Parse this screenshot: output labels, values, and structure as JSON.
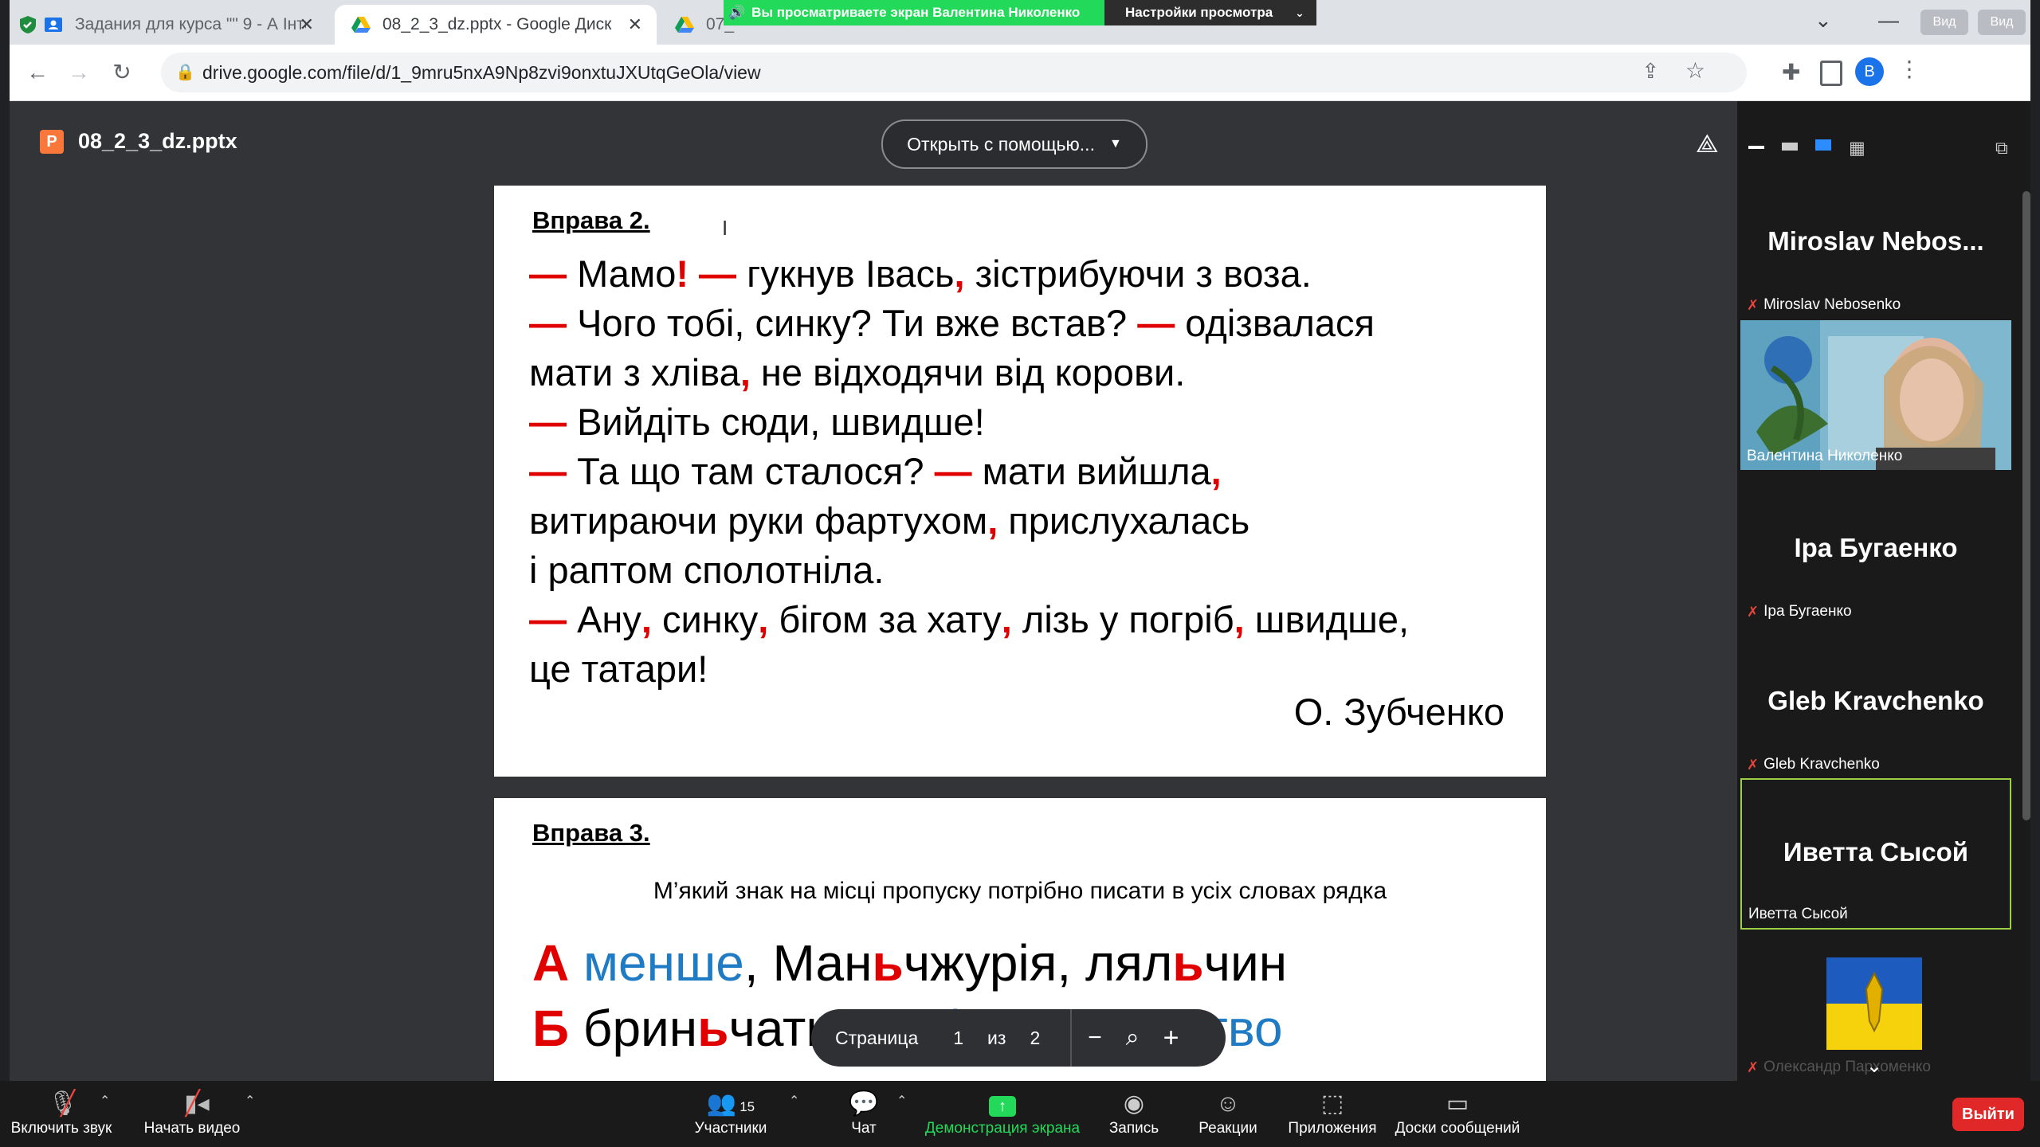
{
  "browser": {
    "tabs": [
      {
        "title": "Задания для курса \"\" 9 - А Інте"
      },
      {
        "title": "08_2_3_dz.pptx - Google Диск"
      },
      {
        "title": "07_"
      }
    ],
    "url": "drive.google.com/file/d/1_9mru5nxA9Np8zvi9onxtuJXUtqGeOla/view",
    "profile_initial": "B",
    "window_button": "Вид"
  },
  "zoom_banner": {
    "viewing_text": "Вы просматриваете экран Валентина Николенко",
    "settings_label": "Настройки просмотра"
  },
  "drive": {
    "file_icon_letter": "P",
    "file_name": "08_2_3_dz.pptx",
    "open_with_label": "Открыть с помощью..."
  },
  "slide1": {
    "title": "Вправа 2.",
    "lines": [
      [
        {
          "t": "— ",
          "c": "r"
        },
        {
          "t": "Мамо"
        },
        {
          "t": "!",
          "c": "r"
        },
        {
          "t": " — ",
          "c": "r"
        },
        {
          "t": "гукнув Івась"
        },
        {
          "t": ",",
          "c": "r"
        },
        {
          "t": " зістрибуючи з воза."
        }
      ],
      [
        {
          "t": "— ",
          "c": "r"
        },
        {
          "t": "Чого тобі, синку? Ти вже встав? "
        },
        {
          "t": "—",
          "c": "r"
        },
        {
          "t": " одізвалася"
        }
      ],
      [
        {
          "t": "мати з хліва"
        },
        {
          "t": ",",
          "c": "r"
        },
        {
          "t": " не відходячи від корови."
        }
      ],
      [
        {
          "t": "— ",
          "c": "r"
        },
        {
          "t": "Вийдіть сюди, швидше!"
        }
      ],
      [
        {
          "t": "— ",
          "c": "r"
        },
        {
          "t": "Та що там сталося? "
        },
        {
          "t": "—",
          "c": "r"
        },
        {
          "t": " мати вийшла"
        },
        {
          "t": ",",
          "c": "r"
        }
      ],
      [
        {
          "t": "витираючи руки фартухом"
        },
        {
          "t": ",",
          "c": "r"
        },
        {
          "t": " прислухалась"
        }
      ],
      [
        {
          "t": "і раптом сполотніла."
        }
      ],
      [
        {
          "t": "— ",
          "c": "r"
        },
        {
          "t": "Ану"
        },
        {
          "t": ",",
          "c": "r"
        },
        {
          "t": " синку"
        },
        {
          "t": ",",
          "c": "r"
        },
        {
          "t": " бігом за хату"
        },
        {
          "t": ",",
          "c": "r"
        },
        {
          "t": " лізь у погріб"
        },
        {
          "t": ",",
          "c": "r"
        },
        {
          "t": " швидше,"
        }
      ],
      [
        {
          "t": "це татари!"
        }
      ]
    ],
    "author": "О. Зубченко"
  },
  "slide2": {
    "title": "Вправа 3.",
    "rule": "М’який знак на місці пропуску потрібно писати в усіх словах рядка",
    "options": [
      [
        {
          "t": "А ",
          "c": "rl"
        },
        {
          "t": "менше",
          "c": "b"
        },
        {
          "t": ", Ман"
        },
        {
          "t": "ь",
          "c": "rl"
        },
        {
          "t": "чжурія, лял"
        },
        {
          "t": "ь",
          "c": "rl"
        },
        {
          "t": "чин"
        }
      ],
      [
        {
          "t": "Б ",
          "c": "rl"
        },
        {
          "t": "брин"
        },
        {
          "t": "ь",
          "c": "rl"
        },
        {
          "t": "чати, "
        },
        {
          "t": "камінчик, панство",
          "c": "b"
        }
      ]
    ]
  },
  "pager": {
    "page_label": "Страница",
    "current": "1",
    "of_label": "из",
    "total": "2"
  },
  "participants": [
    {
      "big": "Miroslav  Nebos...",
      "small": "Miroslav Nebosenko",
      "muted": true
    },
    {
      "big": "",
      "small": "Валентина Николенко",
      "muted": false,
      "video": true
    },
    {
      "big": "Іра Бугаенко",
      "small": "Іра Бугаенко",
      "muted": true
    },
    {
      "big": "Gleb Kravchenko",
      "small": "Gleb Kravchenko",
      "muted": true
    },
    {
      "big": "Иветта Сысой",
      "small": "Иветта Сысой",
      "muted": false,
      "active": true
    },
    {
      "big": "",
      "small": "Олександр Пархоменко",
      "muted": true,
      "flag": true
    }
  ],
  "toolbar": {
    "unmute": "Включить звук",
    "start_video": "Начать видео",
    "participants": "Участники",
    "participants_count": "15",
    "chat": "Чат",
    "share": "Демонстрация экрана",
    "record": "Запись",
    "reactions": "Реакции",
    "apps": "Приложения",
    "whiteboards": "Доски сообщений",
    "leave": "Выйти"
  },
  "colors": {
    "share_green": "#23d959",
    "leave_red": "#e02828",
    "accent_red": "#e00000",
    "accent_blue": "#1f7bc4"
  }
}
